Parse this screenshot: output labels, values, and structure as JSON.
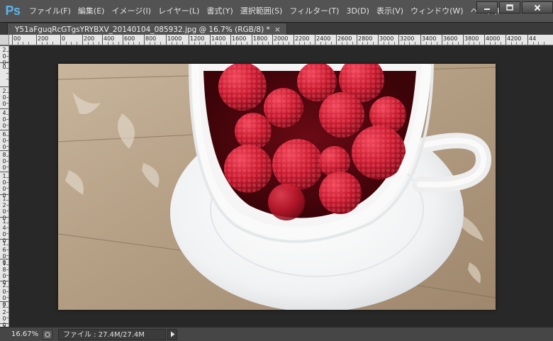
{
  "app": {
    "logo": "Ps"
  },
  "menu": {
    "items": [
      "ファイル(F)",
      "編集(E)",
      "イメージ(I)",
      "レイヤー(L)",
      "書式(Y)",
      "選択範囲(S)",
      "フィルター(T)",
      "3D(D)",
      "表示(V)",
      "ウィンドウ(W)",
      "ヘルプ(H"
    ]
  },
  "window_controls": {
    "minimize_icon": "minimize-icon",
    "maximize_icon": "maximize-icon",
    "close_icon": "close-icon"
  },
  "document": {
    "tab_title": "Y51aFguqRcGTgsYRYBXV_20140104_085932.jpg @ 16.7% (RGB/8) *",
    "close_glyph": "×"
  },
  "ruler_h": {
    "labels": [
      "00",
      "200",
      "0",
      "200",
      "400",
      "600",
      "800",
      "1000",
      "1200",
      "1400",
      "1600",
      "1800",
      "2000",
      "2200",
      "2400",
      "2600",
      "2800",
      "3000",
      "3200",
      "3400",
      "3600",
      "3800",
      "4000",
      "4200",
      "44"
    ]
  },
  "ruler_v": {
    "labels": [
      "2\n0\n0",
      "0",
      "2\n0\n0",
      "4\n0\n0",
      "6\n0\n0",
      "8\n0\n0",
      "1\n0\n0\n0",
      "1\n2\n0\n0",
      "1\n4\n0\n0",
      "1\n6\n0\n0",
      "1\n8\n0\n0",
      "2\n0\n0\n0",
      "2\n2\n0\n0",
      "2\n4\n0"
    ]
  },
  "status": {
    "zoom": "16.67%",
    "info": "ファイル : 27.4M/27.4M",
    "info_icon": "document-info-icon",
    "menu_arrow_icon": "play-arrow-icon"
  },
  "image": {
    "subject": "raspberries-in-white-cup-photo",
    "colors": {
      "wood": "#b9a58d",
      "cup": "#f4f4f4",
      "raspberry": "#c0162b"
    }
  }
}
